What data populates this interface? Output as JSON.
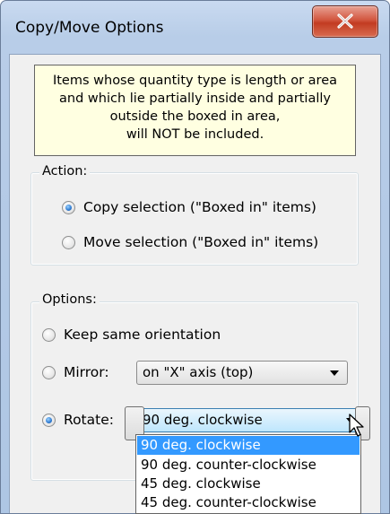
{
  "window": {
    "title": "Copy/Move Options"
  },
  "note": {
    "lines": [
      "Items whose quantity type is length or area",
      "and which lie partially inside and partially",
      "outside the boxed in area,",
      "will NOT be included."
    ]
  },
  "action": {
    "legend": "Action:",
    "options": [
      {
        "label": "Copy selection (\"Boxed in\" items)",
        "checked": true
      },
      {
        "label": "Move selection (\"Boxed in\" items)",
        "checked": false
      }
    ]
  },
  "options": {
    "legend": "Options:",
    "keep_label": "Keep same orientation",
    "mirror_label": "Mirror:",
    "mirror_value": "on \"X\" axis (top)",
    "rotate_label": "Rotate:",
    "rotate_value": "90 deg. clockwise",
    "checked": "rotate"
  },
  "rotate_dropdown": {
    "items": [
      {
        "label": "90 deg. clockwise",
        "selected": true
      },
      {
        "label": "90 deg. counter-clockwise",
        "selected": false
      },
      {
        "label": "45 deg. clockwise",
        "selected": false
      },
      {
        "label": "45 deg. counter-clockwise",
        "selected": false
      }
    ]
  },
  "colors": {
    "note_background": "#ffffe1",
    "selection": "#3399ff",
    "close_button": "#c23c22"
  }
}
